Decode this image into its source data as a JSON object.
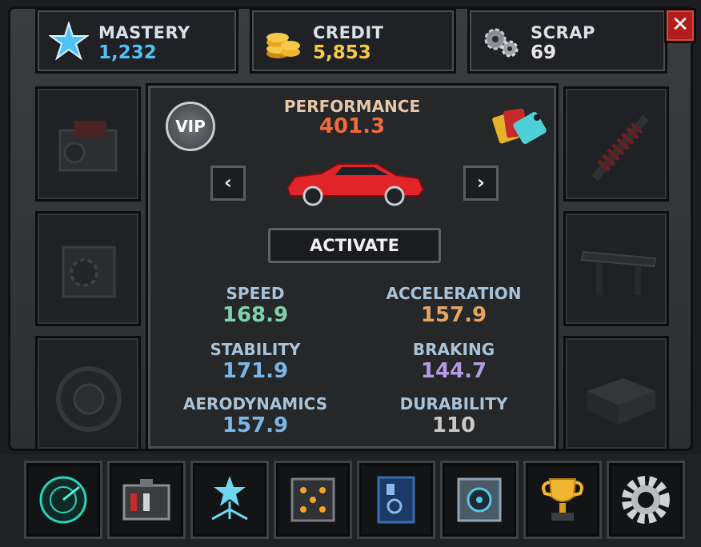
{
  "resources": {
    "mastery": {
      "label": "MASTERY",
      "value": "1,232",
      "icon": "mastery-star-icon",
      "color": "#4fc3f7"
    },
    "credit": {
      "label": "CREDIT",
      "value": "5,853",
      "icon": "gold-coins-icon",
      "color": "#f7c948"
    },
    "scrap": {
      "label": "SCRAP",
      "value": "69",
      "icon": "gears-scrap-icon",
      "color": "#e8e8e8"
    }
  },
  "close": {
    "label": "✕"
  },
  "performance": {
    "label": "PERFORMANCE",
    "value": "401.3"
  },
  "vip": {
    "label": "VIP"
  },
  "activate": {
    "label": "ACTIVATE"
  },
  "nav": {
    "prev": "‹",
    "next": "›"
  },
  "stats": [
    {
      "label": "SPEED",
      "value": "168.9",
      "color": "#7ed1ad"
    },
    {
      "label": "ACCELERATION",
      "value": "157.9",
      "color": "#e6a45e"
    },
    {
      "label": "STABILITY",
      "value": "171.9",
      "color": "#7ab6e8"
    },
    {
      "label": "BRAKING",
      "value": "144.7",
      "color": "#b49be6"
    },
    {
      "label": "AERODYNAMICS",
      "value": "157.9",
      "color": "#7ab6e8"
    },
    {
      "label": "DURABILITY",
      "value": "110",
      "color": "#c8c8c8"
    }
  ],
  "left_slots": [
    "engine-part-icon",
    "gearbox-part-icon",
    "tire-part-icon"
  ],
  "right_slots": [
    "suspension-part-icon",
    "spoiler-part-icon",
    "ecu-part-icon"
  ],
  "bottom_buttons": [
    "radar-icon",
    "toolbox-icon",
    "skill-tree-icon",
    "dice-crate-icon",
    "blueprint-book-icon",
    "safe-vault-icon",
    "trophy-icon",
    "settings-gear-icon"
  ]
}
